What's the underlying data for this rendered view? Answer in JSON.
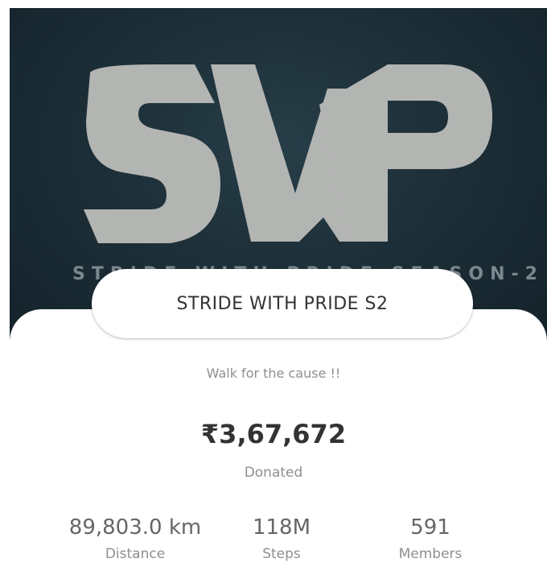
{
  "banner": {
    "logo_text": "SWP",
    "subtitle": "STRIDE WITH PRIDE SEASON-2",
    "background_color": "#1d2f38",
    "logo_color": "#b3b5b3"
  },
  "event": {
    "title": "STRIDE WITH PRIDE S2",
    "tagline": "Walk for the cause !!"
  },
  "donation": {
    "amount": "₹3,67,672",
    "label": "Donated"
  },
  "stats": {
    "distance": {
      "value": "89,803.0 km",
      "label": "Distance"
    },
    "steps": {
      "value": "118M",
      "label": "Steps"
    },
    "members": {
      "value": "591",
      "label": "Members"
    }
  }
}
